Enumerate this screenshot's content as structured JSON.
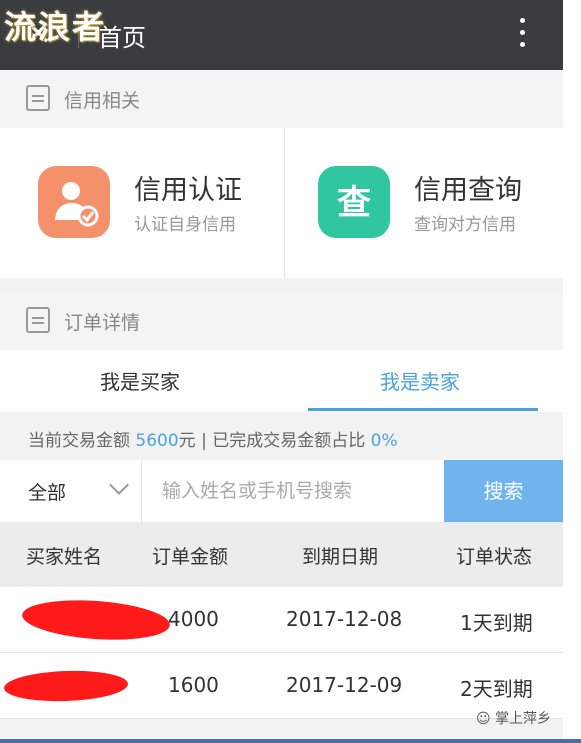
{
  "header": {
    "close_glyph": "✕",
    "title": "首页",
    "watermark": "流浪者"
  },
  "credit_section": {
    "label": "信用相关",
    "cards": [
      {
        "title": "信用认证",
        "subtitle": "认证自身信用",
        "icon": "user-check-icon",
        "color": "#f5916a"
      },
      {
        "title": "信用查询",
        "subtitle": "查询对方信用",
        "icon": "query-icon",
        "color": "#2fc6a0",
        "glyph": "查"
      }
    ]
  },
  "order_section": {
    "label": "订单详情"
  },
  "tabs": [
    {
      "label": "我是买家",
      "active": false
    },
    {
      "label": "我是卖家",
      "active": true
    }
  ],
  "summary": {
    "prefix": "当前交易金额",
    "amount": "5600",
    "unit": "元 | 已完成交易金额占比",
    "percent": "0%"
  },
  "filter": {
    "selected": "全部",
    "search_placeholder": "输入姓名或手机号搜索",
    "search_button": "搜索"
  },
  "table": {
    "columns": [
      "买家姓名",
      "订单金额",
      "到期日期",
      "订单状态"
    ],
    "rows": [
      {
        "name": "",
        "amount": "4000",
        "due": "2017-12-08",
        "status": "1天到期"
      },
      {
        "name": "",
        "amount": "1600",
        "due": "2017-12-09",
        "status": "2天到期"
      }
    ]
  },
  "footer": {
    "watermark": "掌上萍乡"
  },
  "colors": {
    "accent": "#4aa3df",
    "header_bg": "#3a3d40",
    "button": "#6fb4ec"
  }
}
